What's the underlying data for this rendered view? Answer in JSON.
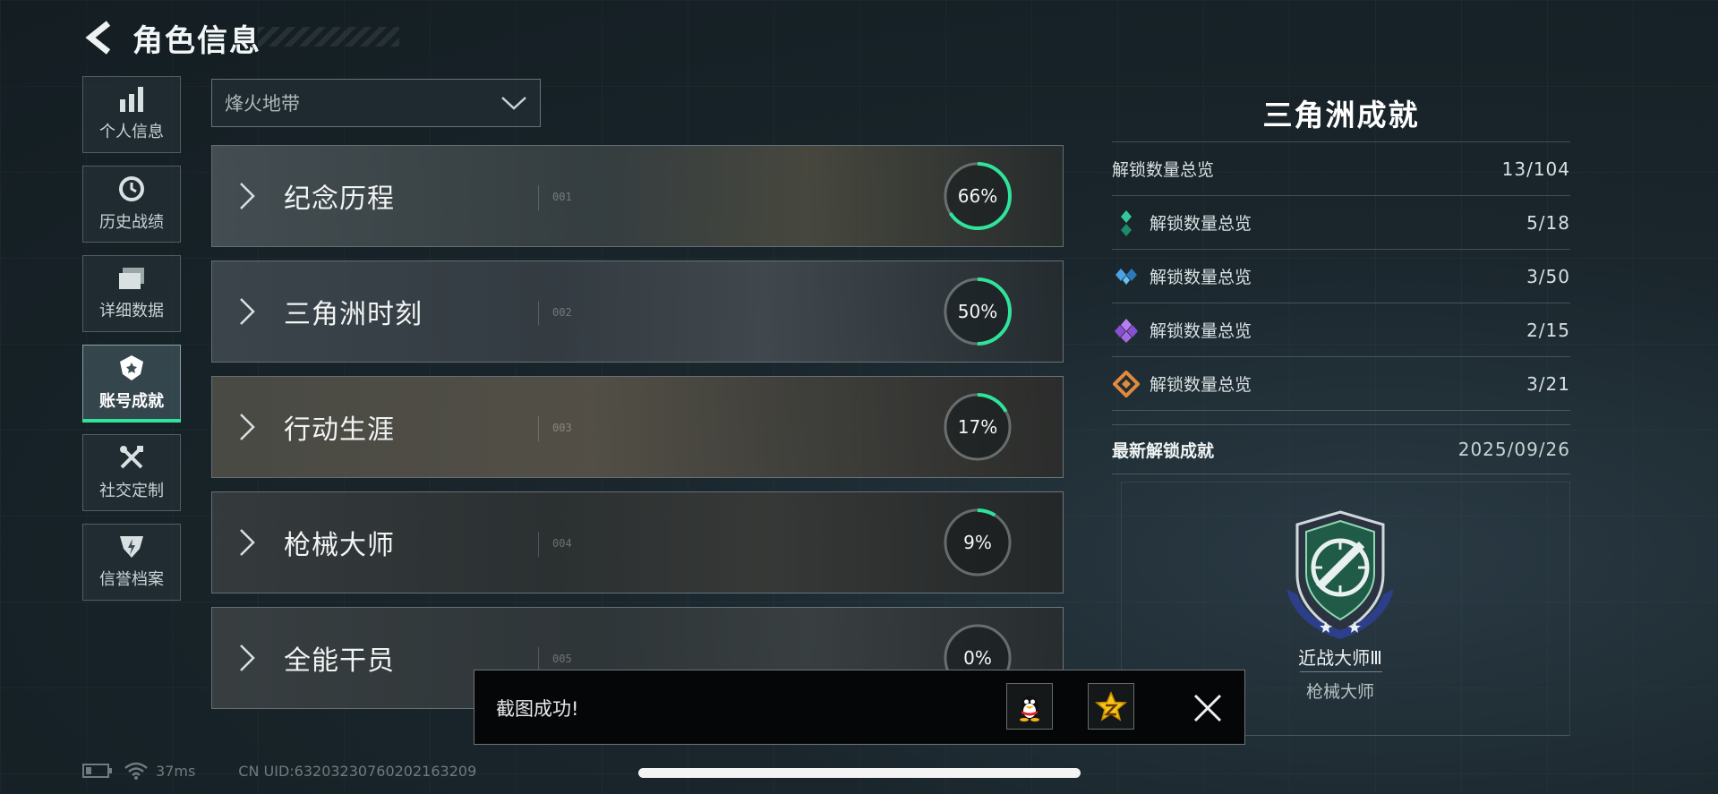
{
  "header": {
    "title": "角色信息"
  },
  "sidebar": {
    "items": [
      {
        "label": "个人信息",
        "icon": "bar-chart-icon"
      },
      {
        "label": "历史战绩",
        "icon": "clock-icon"
      },
      {
        "label": "详细数据",
        "icon": "folder-icon"
      },
      {
        "label": "账号成就",
        "icon": "achievement-shield-icon",
        "active": true
      },
      {
        "label": "社交定制",
        "icon": "tools-icon"
      },
      {
        "label": "信誉档案",
        "icon": "reputation-icon"
      }
    ]
  },
  "mode_select": {
    "value": "烽火地带"
  },
  "categories": [
    {
      "name": "纪念历程",
      "index": "001",
      "percent_text": "66%",
      "progress": 0.66
    },
    {
      "name": "三角洲时刻",
      "index": "002",
      "percent_text": "50%",
      "progress": 0.5
    },
    {
      "name": "行动生涯",
      "index": "003",
      "percent_text": "17%",
      "progress": 0.17
    },
    {
      "name": "枪械大师",
      "index": "004",
      "percent_text": "9%",
      "progress": 0.09
    },
    {
      "name": "全能干员",
      "index": "005",
      "percent_text": "0%",
      "progress": 0.0
    }
  ],
  "panel": {
    "title": "三角洲成就",
    "overview": {
      "label": "解锁数量总览",
      "value": "13/104"
    },
    "tiers": [
      {
        "label": "解锁数量总览",
        "value": "5/18",
        "icon": "green-diamond-icon",
        "color": "#35c79a"
      },
      {
        "label": "解锁数量总览",
        "value": "3/50",
        "icon": "blue-diamond-icon",
        "color": "#4aa3e6"
      },
      {
        "label": "解锁数量总览",
        "value": "2/15",
        "icon": "purple-diamond-icon",
        "color": "#a46be0"
      },
      {
        "label": "解锁数量总览",
        "value": "3/21",
        "icon": "orange-diamond-icon",
        "color": "#e08a3c"
      }
    ],
    "latest": {
      "label": "最新解锁成就",
      "date": "2025/09/26"
    },
    "badge": {
      "name": "近战大师Ⅲ",
      "category": "枪械大师"
    }
  },
  "toast": {
    "message": "截图成功!"
  },
  "footer": {
    "ping": "37ms",
    "uid": "CN UID:63203230760202163209"
  },
  "colors": {
    "accent": "#2fe39a",
    "progress_ring": "#2fe39a"
  }
}
